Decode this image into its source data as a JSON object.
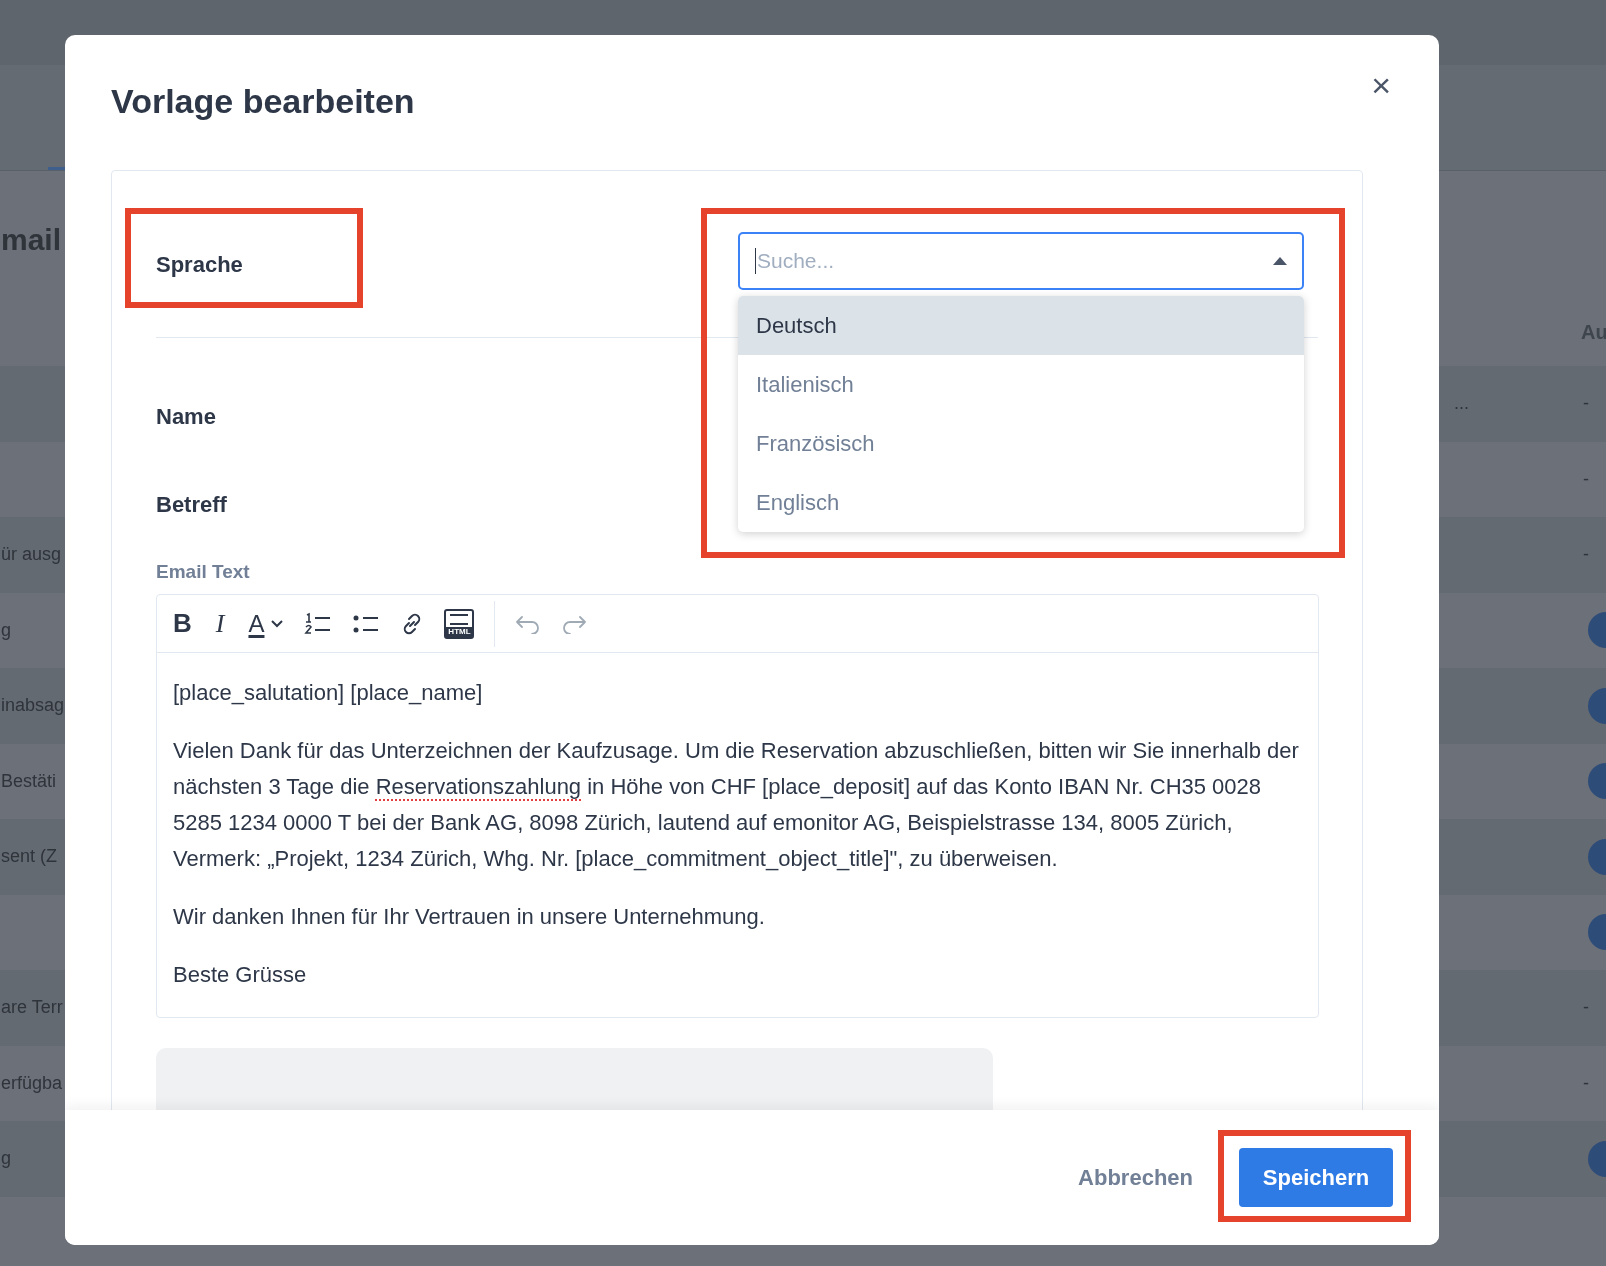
{
  "background_page": {
    "heading": "mail",
    "column_header": "Au",
    "rows": [
      {
        "label": "",
        "extra": "...",
        "status": {
          "kind": "dash",
          "text": "-"
        }
      },
      {
        "label": "",
        "status": {
          "kind": "dash",
          "text": "-"
        }
      },
      {
        "label": "ür ausg",
        "status": {
          "kind": "dash",
          "text": "-"
        }
      },
      {
        "label": "g",
        "status": {
          "kind": "circle"
        }
      },
      {
        "label": "inabsag",
        "status": {
          "kind": "circle"
        }
      },
      {
        "label": "Bestäti",
        "status": {
          "kind": "circle"
        }
      },
      {
        "label": "sent (Z",
        "status": {
          "kind": "circle"
        }
      },
      {
        "label": "",
        "status": {
          "kind": "circle"
        }
      },
      {
        "label": "are Terr",
        "status": {
          "kind": "dash",
          "text": "-"
        }
      },
      {
        "label": "erfügba",
        "status": {
          "kind": "dash",
          "text": "-"
        }
      },
      {
        "label": "g",
        "status": {
          "kind": "circle"
        }
      }
    ]
  },
  "dialog": {
    "title": "Vorlage bearbeiten",
    "close": "×",
    "language": {
      "label": "Sprache",
      "label_highlighted": true,
      "select_highlighted": true,
      "placeholder": "Suche...",
      "expanded": true,
      "options": [
        {
          "label": "Deutsch",
          "selected": true
        },
        {
          "label": "Italienisch",
          "selected": false
        },
        {
          "label": "Französisch",
          "selected": false
        },
        {
          "label": "Englisch",
          "selected": false
        }
      ]
    },
    "fields": [
      {
        "label": "Name"
      },
      {
        "label": "Betreff"
      }
    ],
    "email_text": {
      "label": "Email Text",
      "toolbar": [
        {
          "kind": "bold",
          "label": "B"
        },
        {
          "kind": "italic",
          "label": "I"
        },
        {
          "kind": "color",
          "label": "A"
        },
        {
          "kind": "ordered_list"
        },
        {
          "kind": "bullet_list"
        },
        {
          "kind": "link"
        },
        {
          "kind": "html",
          "label": "HTML"
        },
        {
          "kind": "separator"
        },
        {
          "kind": "undo"
        },
        {
          "kind": "redo"
        }
      ],
      "paragraphs": [
        [
          {
            "text": "[place_salutation] [place_name]",
            "misspelled": false
          }
        ],
        [
          {
            "text": "Vielen Dank für das Unterzeichnen der Kaufzusage. Um die Reservation abzuschließen, bitten wir Sie innerhalb der nächsten 3 Tage die ",
            "misspelled": false
          },
          {
            "text": "Reservationszahlung",
            "misspelled": true
          },
          {
            "text": " in Höhe von CHF [place_deposit] auf das Konto IBAN Nr. CH35 0028 5285 1234 0000 T bei der Bank AG, 8098 Zürich, lautend auf emonitor AG, Beispielstrasse 134, 8005 Zürich, Vermerk: „Projekt, 1234 Zürich, Whg. Nr. [place_commitment_object_title]\",  zu überweisen.",
            "misspelled": false
          }
        ],
        [
          {
            "text": "Wir danken Ihnen für Ihr Vertrauen in unsere Unternehmung.",
            "misspelled": false
          }
        ],
        [
          {
            "text": "Beste Grüsse",
            "misspelled": false
          }
        ]
      ]
    },
    "footer": {
      "cancel": "Abbrechen",
      "save": "Speichern",
      "save_highlighted": true
    }
  }
}
